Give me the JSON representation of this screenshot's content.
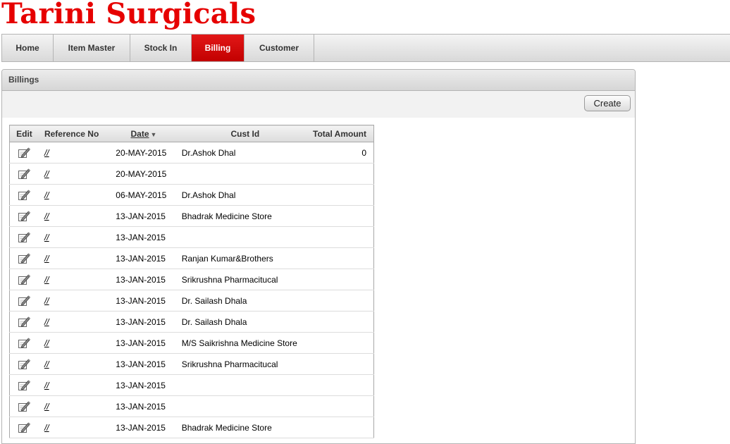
{
  "app": {
    "title": "Tarini Surgicals"
  },
  "nav": {
    "tabs": [
      {
        "label": "Home",
        "active": false
      },
      {
        "label": "Item Master",
        "active": false
      },
      {
        "label": "Stock In",
        "active": false
      },
      {
        "label": "Billing",
        "active": true
      },
      {
        "label": "Customer",
        "active": false
      }
    ]
  },
  "panel": {
    "title": "Billings",
    "create_label": "Create"
  },
  "table": {
    "headers": {
      "edit": "Edit",
      "ref": "Reference No",
      "date": "Date",
      "date_sort": "▼",
      "cust": "Cust Id",
      "amount": "Total Amount"
    },
    "rows": [
      {
        "ref": "//",
        "date": "20-MAY-2015",
        "cust": "Dr.Ashok Dhal",
        "amount": "0"
      },
      {
        "ref": "//",
        "date": "20-MAY-2015",
        "cust": "",
        "amount": ""
      },
      {
        "ref": "//",
        "date": "06-MAY-2015",
        "cust": "Dr.Ashok Dhal",
        "amount": ""
      },
      {
        "ref": "//",
        "date": "13-JAN-2015",
        "cust": "Bhadrak Medicine Store",
        "amount": ""
      },
      {
        "ref": "//",
        "date": "13-JAN-2015",
        "cust": "",
        "amount": ""
      },
      {
        "ref": "//",
        "date": "13-JAN-2015",
        "cust": "Ranjan Kumar&Brothers",
        "amount": ""
      },
      {
        "ref": "//",
        "date": "13-JAN-2015",
        "cust": "Srikrushna Pharmacitucal",
        "amount": ""
      },
      {
        "ref": "//",
        "date": "13-JAN-2015",
        "cust": "Dr. Sailash Dhala",
        "amount": ""
      },
      {
        "ref": "//",
        "date": "13-JAN-2015",
        "cust": "Dr. Sailash Dhala",
        "amount": ""
      },
      {
        "ref": "//",
        "date": "13-JAN-2015",
        "cust": "M/S Saikrishna Medicine Store",
        "amount": ""
      },
      {
        "ref": "//",
        "date": "13-JAN-2015",
        "cust": "Srikrushna Pharmacitucal",
        "amount": ""
      },
      {
        "ref": "//",
        "date": "13-JAN-2015",
        "cust": "",
        "amount": ""
      },
      {
        "ref": "//",
        "date": "13-JAN-2015",
        "cust": "",
        "amount": ""
      },
      {
        "ref": "//",
        "date": "13-JAN-2015",
        "cust": "Bhadrak Medicine Store",
        "amount": ""
      }
    ]
  },
  "icons": {
    "edit": "edit-icon",
    "sort": "sort-desc-icon"
  },
  "colors": {
    "brand": "#e60000",
    "active_tab": "#d10000"
  }
}
